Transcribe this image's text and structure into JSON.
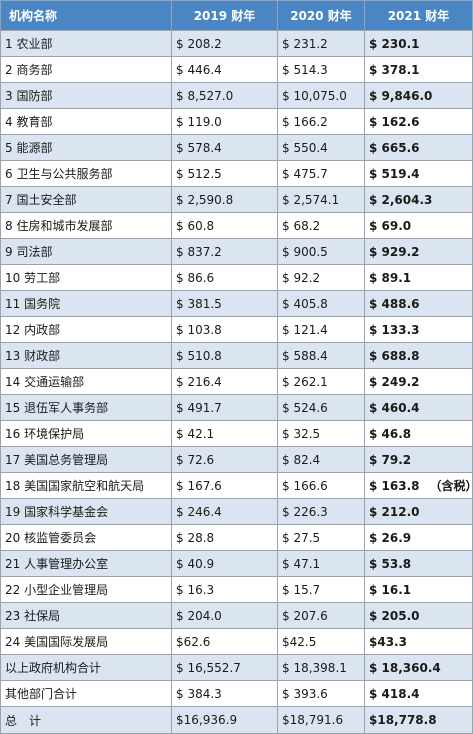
{
  "table": {
    "headers": [
      "机构名称",
      "2019 财年",
      "2020 财年",
      "2021 财年"
    ],
    "rows": [
      {
        "name": "1 农业部",
        "fy2019": "$ 208.2",
        "fy2020": "$ 231.2",
        "fy2021": "$ 230.1",
        "note": ""
      },
      {
        "name": "2 商务部",
        "fy2019": "$ 446.4",
        "fy2020": "$ 514.3",
        "fy2021": "$ 378.1",
        "note": ""
      },
      {
        "name": "3 国防部",
        "fy2019": "$ 8,527.0",
        "fy2020": "$ 10,075.0",
        "fy2021": "$ 9,846.0",
        "note": ""
      },
      {
        "name": "4 教育部",
        "fy2019": "$ 119.0",
        "fy2020": "$ 166.2",
        "fy2021": "$ 162.6",
        "note": ""
      },
      {
        "name": "5 能源部",
        "fy2019": "$ 578.4",
        "fy2020": "$ 550.4",
        "fy2021": "$ 665.6",
        "note": ""
      },
      {
        "name": "6 卫生与公共服务部",
        "fy2019": "$ 512.5",
        "fy2020": "$ 475.7",
        "fy2021": "$ 519.4",
        "note": ""
      },
      {
        "name": "7 国土安全部",
        "fy2019": "$ 2,590.8",
        "fy2020": "$ 2,574.1",
        "fy2021": "$ 2,604.3",
        "note": ""
      },
      {
        "name": "8 住房和城市发展部",
        "fy2019": "$ 60.8",
        "fy2020": "$ 68.2",
        "fy2021": "$ 69.0",
        "note": ""
      },
      {
        "name": "9 司法部",
        "fy2019": "$ 837.2",
        "fy2020": "$ 900.5",
        "fy2021": "$ 929.2",
        "note": ""
      },
      {
        "name": "10 劳工部",
        "fy2019": "$ 86.6",
        "fy2020": "$ 92.2",
        "fy2021": "$ 89.1",
        "note": ""
      },
      {
        "name": "11 国务院",
        "fy2019": "$ 381.5",
        "fy2020": "$ 405.8",
        "fy2021": "$ 488.6",
        "note": ""
      },
      {
        "name": "12 内政部",
        "fy2019": "$ 103.8",
        "fy2020": "$ 121.4",
        "fy2021": "$ 133.3",
        "note": ""
      },
      {
        "name": "13 财政部",
        "fy2019": "$ 510.8",
        "fy2020": "$ 588.4",
        "fy2021": "$ 688.8",
        "note": ""
      },
      {
        "name": "14 交通运输部",
        "fy2019": "$ 216.4",
        "fy2020": "$ 262.1",
        "fy2021": "$ 249.2",
        "note": ""
      },
      {
        "name": "15 退伍军人事务部",
        "fy2019": "$ 491.7",
        "fy2020": "$ 524.6",
        "fy2021": "$ 460.4",
        "note": ""
      },
      {
        "name": "16 环境保护局",
        "fy2019": "$ 42.1",
        "fy2020": "$ 32.5",
        "fy2021": "$ 46.8",
        "note": ""
      },
      {
        "name": "17 美国总务管理局",
        "fy2019": "$ 72.6",
        "fy2020": "$ 82.4",
        "fy2021": "$ 79.2",
        "note": ""
      },
      {
        "name": "18 美国国家航空和航天局",
        "fy2019": "$ 167.6",
        "fy2020": "$ 166.6",
        "fy2021": "$ 163.8",
        "note": "（含税）"
      },
      {
        "name": "19 国家科学基金会",
        "fy2019": "$ 246.4",
        "fy2020": "$ 226.3",
        "fy2021": "$ 212.0",
        "note": ""
      },
      {
        "name": "20 核监管委员会",
        "fy2019": "$ 28.8",
        "fy2020": "$ 27.5",
        "fy2021": "$ 26.9",
        "note": ""
      },
      {
        "name": "21 人事管理办公室",
        "fy2019": "$ 40.9",
        "fy2020": "$ 47.1",
        "fy2021": "$ 53.8",
        "note": ""
      },
      {
        "name": "22 小型企业管理局",
        "fy2019": "$ 16.3",
        "fy2020": "$ 15.7",
        "fy2021": "$ 16.1",
        "note": ""
      },
      {
        "name": "23 社保局",
        "fy2019": "$ 204.0",
        "fy2020": "$ 207.6",
        "fy2021": "$ 205.0",
        "note": ""
      },
      {
        "name": "24 美国国际发展局",
        "fy2019": "$62.6",
        "fy2020": "$42.5",
        "fy2021": "$43.3",
        "note": ""
      },
      {
        "name": "以上政府机构合计",
        "fy2019": "$ 16,552.7",
        "fy2020": "$ 18,398.1",
        "fy2021": "$ 18,360.4",
        "note": ""
      },
      {
        "name": "其他部门合计",
        "fy2019": "$ 384.3",
        "fy2020": "$ 393.6",
        "fy2021": "$ 418.4",
        "note": ""
      },
      {
        "name": "总　计",
        "fy2019": "$16,936.9",
        "fy2020": "$18,791.6",
        "fy2021": "$18,778.8",
        "note": ""
      }
    ]
  },
  "colors": {
    "header_bg": "#4a86c3",
    "shade_row_bg": "#dbe5f1",
    "grid_line": "#9aa3ad"
  }
}
